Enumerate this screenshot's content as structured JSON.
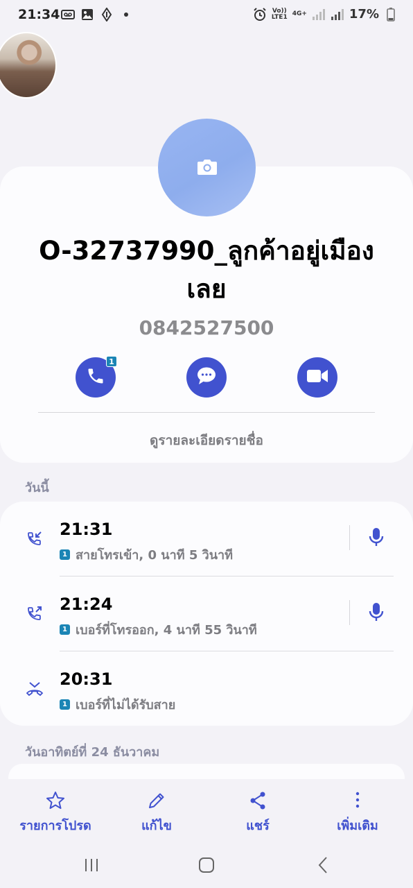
{
  "status_bar": {
    "time": "21:34",
    "network_label_top": "Vo))",
    "network_label_bottom": "LTE1",
    "network_type": "4G+",
    "battery": "17%"
  },
  "contact": {
    "name": "O-32737990_ลูกค้าอยู่เมือง เลย",
    "number": "0842527500",
    "call_badge": "1",
    "details_link": "ดูรายละเอียดรายชื่อ"
  },
  "sections": {
    "today": "วันนี้",
    "sunday": "วันอาทิตย์ที่ 24 ธันวาคม"
  },
  "call_log": [
    {
      "time": "21:31",
      "sim": "1",
      "description": "สายโทรเข้า, 0 นาที 5 วินาที",
      "direction": "incoming",
      "has_recording": true
    },
    {
      "time": "21:24",
      "sim": "1",
      "description": "เบอร์ที่โทรออก, 4 นาที 55 วินาที",
      "direction": "outgoing",
      "has_recording": true
    },
    {
      "time": "20:31",
      "sim": "1",
      "description": "เบอร์ที่ไม่ได้รับสาย",
      "direction": "missed",
      "has_recording": false
    }
  ],
  "bottom_bar": {
    "favorite": "รายการโปรด",
    "edit": "แก้ไข",
    "share": "แชร์",
    "more": "เพิ่มเติม"
  },
  "colors": {
    "accent": "#4152cf",
    "avatar_bg": "#8eaded",
    "sim_badge": "#1b85b5",
    "background": "#f3f2f7"
  }
}
